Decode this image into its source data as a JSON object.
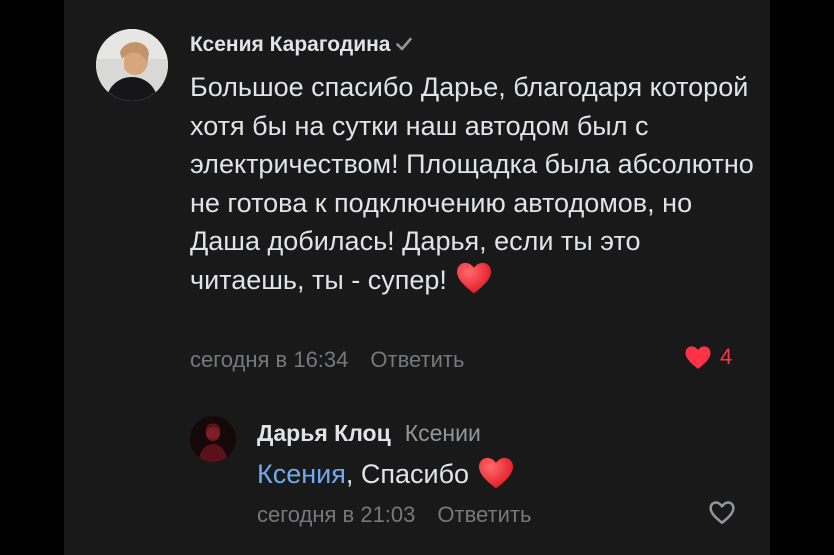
{
  "comment": {
    "author": "Ксения Карагодина",
    "verified_icon": "verified-check-icon",
    "text": "Большое спасибо Дарье, благодаря которой хотя бы на сутки наш автодом был с электричеством! Площадка была абсолютно не готова к подключению автодомов, но Даша добилась! Дарья, если ты это читаешь, ты - супер!",
    "emoji": "red-heart-emoji",
    "timestamp": "сегодня в 16:34",
    "reply_label": "Ответить",
    "likes_count": "4",
    "like_icon": "filled-heart-icon"
  },
  "reply": {
    "author": "Дарья Клоц",
    "reply_to": "Ксении",
    "mention": "Ксения",
    "text": ", Спасибо",
    "emoji": "red-heart-emoji",
    "timestamp": "сегодня в 21:03",
    "reply_label": "Ответить",
    "like_icon": "outline-heart-icon"
  },
  "colors": {
    "background": "#19191a",
    "text_primary": "#e1e3e6",
    "text_secondary": "#76787a",
    "link": "#71aaeb",
    "like_active": "#ff3347"
  }
}
